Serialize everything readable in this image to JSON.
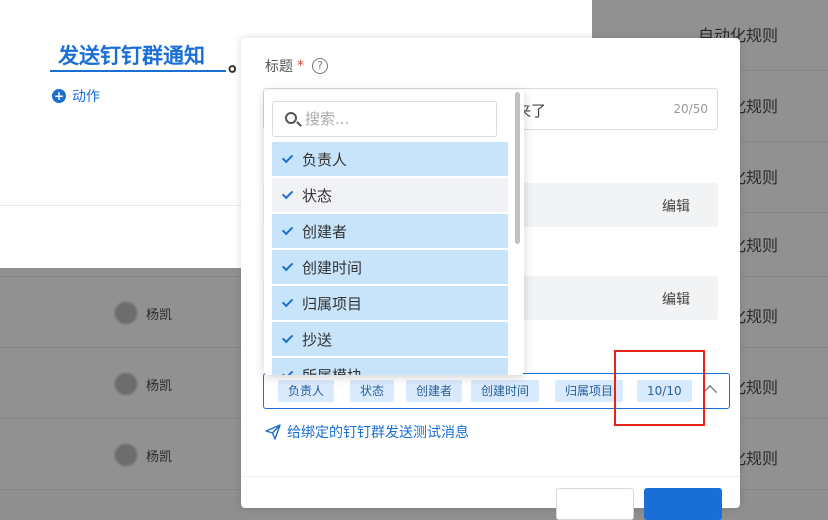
{
  "background": {
    "rows": [
      {
        "rule": "自动化规则",
        "user": ""
      },
      {
        "rule": "化规则",
        "user": ""
      },
      {
        "rule": "化规则",
        "user": ""
      },
      {
        "rule": "化规则",
        "user": ""
      },
      {
        "rule": "化规则",
        "user": "杨凯"
      },
      {
        "rule": "化规则",
        "user": "杨凯"
      },
      {
        "rule": "化规则",
        "user": "杨凯"
      }
    ]
  },
  "left_panel": {
    "title": "发送钉钉群通知",
    "trailing": "。",
    "action_label": "动作"
  },
  "dialog": {
    "title_label": "标题",
    "required_mark": "*",
    "help_symbol": "?",
    "title_suffix_text": "来了",
    "title_counter": "20/50",
    "edit_label": "编辑",
    "tags": [
      "负责人",
      "状态",
      "创建者",
      "创建时间",
      "归属项目"
    ],
    "tag_count": "10/10",
    "send_test_label": "给绑定的钉钉群发送测试消息"
  },
  "dropdown": {
    "search_placeholder": "搜索...",
    "options": [
      {
        "label": "负责人",
        "selected": true
      },
      {
        "label": "状态",
        "selected": true
      },
      {
        "label": "创建者",
        "selected": true
      },
      {
        "label": "创建时间",
        "selected": true
      },
      {
        "label": "归属项目",
        "selected": true
      },
      {
        "label": "抄送",
        "selected": true
      },
      {
        "label": "所属模块",
        "selected": true
      }
    ]
  },
  "colors": {
    "accent": "#1a6fd6",
    "highlight": "#e5231b",
    "selected_option_bg": "#c7e4fb"
  }
}
